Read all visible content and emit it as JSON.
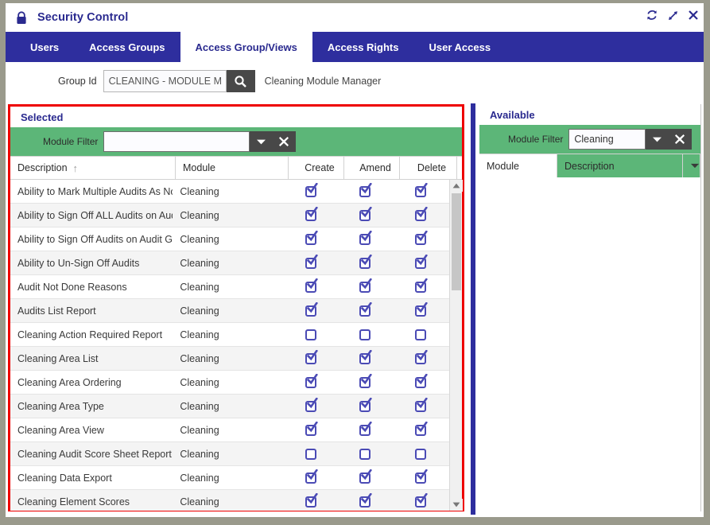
{
  "window": {
    "title": "Security Control",
    "lock_icon": "lock-icon",
    "controls": [
      {
        "name": "refresh-icon",
        "glyph": "⟳"
      },
      {
        "name": "expand-icon",
        "glyph": "↗"
      },
      {
        "name": "close-icon",
        "glyph": "✕"
      }
    ],
    "frame_color": "#9a9a8c"
  },
  "tabs": [
    {
      "label": "Users",
      "active": false
    },
    {
      "label": "Access Groups",
      "active": false
    },
    {
      "label": "Access Group/Views",
      "active": true
    },
    {
      "label": "Access Rights",
      "active": false
    },
    {
      "label": "User Access",
      "active": false
    }
  ],
  "toolbar": {
    "group_id_label": "Group Id",
    "group_id_value": "CLEANING - MODULE MANA",
    "group_id_placeholder": "Group Id",
    "search_icon": "search-icon",
    "group_description": "Cleaning Module Manager"
  },
  "selected_panel": {
    "title": "Selected",
    "filter_label": "Module Filter",
    "filter_value": "",
    "filter_placeholder": "",
    "dropdown_icon": "chevron-down-icon",
    "clear_icon": "clear-icon",
    "columns": [
      "Description",
      "Module",
      "Create",
      "Amend",
      "Delete"
    ],
    "sort_column": "Description",
    "sort_direction": "↑",
    "rows": [
      {
        "description": "Ability to Mark Multiple Audits As Not...",
        "module": "Cleaning",
        "create": true,
        "amend": true,
        "delete": true
      },
      {
        "description": "Ability to Sign Off ALL Audits on Audit...",
        "module": "Cleaning",
        "create": true,
        "amend": true,
        "delete": true
      },
      {
        "description": "Ability to Sign Off Audits on Audit Gro...",
        "module": "Cleaning",
        "create": true,
        "amend": true,
        "delete": true
      },
      {
        "description": "Ability to Un-Sign Off Audits",
        "module": "Cleaning",
        "create": true,
        "amend": true,
        "delete": true
      },
      {
        "description": "Audit Not Done Reasons",
        "module": "Cleaning",
        "create": true,
        "amend": true,
        "delete": true
      },
      {
        "description": "Audits List Report",
        "module": "Cleaning",
        "create": true,
        "amend": true,
        "delete": true
      },
      {
        "description": "Cleaning Action Required Report",
        "module": "Cleaning",
        "create": false,
        "amend": false,
        "delete": false
      },
      {
        "description": "Cleaning Area List",
        "module": "Cleaning",
        "create": true,
        "amend": true,
        "delete": true
      },
      {
        "description": "Cleaning Area Ordering",
        "module": "Cleaning",
        "create": true,
        "amend": true,
        "delete": true
      },
      {
        "description": "Cleaning Area Type",
        "module": "Cleaning",
        "create": true,
        "amend": true,
        "delete": true
      },
      {
        "description": "Cleaning Area View",
        "module": "Cleaning",
        "create": true,
        "amend": true,
        "delete": true
      },
      {
        "description": "Cleaning Audit Score Sheet Report",
        "module": "Cleaning",
        "create": false,
        "amend": false,
        "delete": false
      },
      {
        "description": "Cleaning Data Export",
        "module": "Cleaning",
        "create": true,
        "amend": true,
        "delete": true
      },
      {
        "description": "Cleaning Element Scores",
        "module": "Cleaning",
        "create": true,
        "amend": true,
        "delete": true
      }
    ],
    "scrollbar": {
      "up_icon": "scroll-up-icon",
      "down_icon": "scroll-down-icon"
    },
    "border_color": "#ee0000"
  },
  "available_panel": {
    "title": "Available",
    "filter_label": "Module Filter",
    "filter_value": "Cleaning",
    "filter_placeholder": "",
    "dropdown_icon": "chevron-down-icon",
    "clear_icon": "clear-icon",
    "columns": [
      "Module",
      "Description"
    ],
    "column_menu_icon": "chevron-down-icon",
    "rows": []
  },
  "colors": {
    "tab_bar": "#2e2e9e",
    "filter_bar_green": "#5cb678",
    "accent_indigo": "#2a2a8f",
    "checkbox": "#4b4bb5",
    "selected_border": "#ee0000"
  }
}
